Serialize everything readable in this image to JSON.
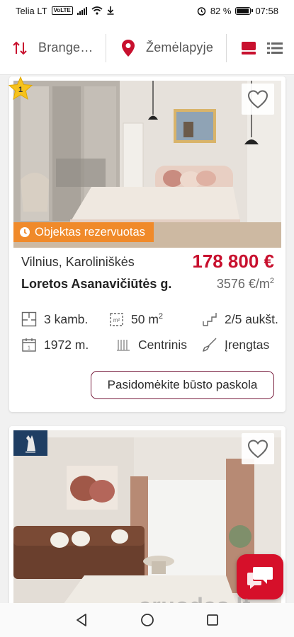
{
  "status_bar": {
    "carrier": "Telia LT",
    "volte": "VoLTE",
    "battery": "82 %",
    "battery_level": 0.82,
    "time": "07:58"
  },
  "toolbar": {
    "sort_label": "Brange…",
    "map_label": "Žemėlapyje"
  },
  "listings": [
    {
      "badge": "1",
      "status_label": "Objektas rezervuotas",
      "location": "Vilnius, Karoliniškės",
      "street": "Loretos Asanavičiūtės g.",
      "price": "178 800 €",
      "price_per_m2": "3576 €/m",
      "price_per_m2_sup": "2",
      "features": {
        "rooms": "3 kamb.",
        "area": "50 m",
        "area_sup": "2",
        "floor": "2/5 aukšt.",
        "year": "1972 m.",
        "heating": "Centrinis",
        "fitout": "Įrengtas"
      },
      "loan_button": "Pasidomėkite būsto paskola"
    },
    {
      "agency_logo": "agency-logo"
    }
  ],
  "watermark": "aruodas.lt",
  "colors": {
    "brand_red": "#c8102e",
    "reserved_orange": "#f08a2a",
    "button_border": "#7a2040",
    "chat_red": "#d6102a",
    "star_yellow": "#f6c21c"
  }
}
